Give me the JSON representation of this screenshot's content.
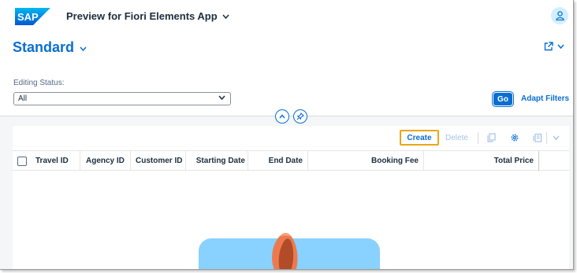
{
  "shell": {
    "app_title": "Preview for Fiori Elements App"
  },
  "header": {
    "variant_name": "Standard"
  },
  "filters": {
    "editing_status_label": "Editing Status:",
    "editing_status_value": "All",
    "go_label": "Go",
    "adapt_filters_label": "Adapt Filters"
  },
  "toolbar": {
    "create_label": "Create",
    "delete_label": "Delete"
  },
  "table": {
    "columns": [
      "Travel ID",
      "Agency ID",
      "Customer ID",
      "Starting Date",
      "End Date",
      "Booking Fee",
      "Total Price"
    ]
  },
  "colors": {
    "brand_blue": "#0a6ed1",
    "focus_outline": "#e9a719",
    "illustration": "#89d1ff"
  },
  "icons": [
    "sap-logo",
    "chevron-down-icon",
    "user-icon",
    "share-icon",
    "collapse-icon",
    "pin-icon",
    "copy-icon",
    "settings-icon",
    "export-icon"
  ]
}
